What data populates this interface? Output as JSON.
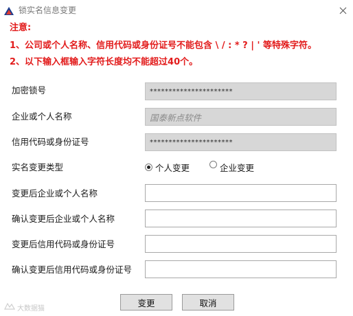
{
  "window": {
    "title": "锁实名信息变更",
    "app_icon": "triangle-logo-icon",
    "close_icon": "close-icon"
  },
  "notice": {
    "title": "注意:",
    "line1": "1、公司或个人名称、信用代码或身份证号不能包含 \\ / : * ? | ' 等特殊字符。",
    "line2": "2、以下输入框输入字符长度均不能超过40个。"
  },
  "form": {
    "lock_no": {
      "label": "加密锁号",
      "value": "**********************"
    },
    "name": {
      "label": "企业或个人名称",
      "value": "国泰新点软件"
    },
    "credit_code": {
      "label": "信用代码或身份证号",
      "value": "**********************"
    },
    "change_type": {
      "label": "实名变更类型",
      "options": [
        "个人变更",
        "企业变更"
      ],
      "selected": "个人变更"
    },
    "new_name": {
      "label": "变更后企业或个人名称",
      "value": ""
    },
    "confirm_new_name": {
      "label": "确认变更后企业或个人名称",
      "value": ""
    },
    "new_code": {
      "label": "变更后信用代码或身份证号",
      "value": ""
    },
    "confirm_new_code": {
      "label": "确认变更后信用代码或身份证号",
      "value": ""
    }
  },
  "buttons": {
    "change": "变更",
    "cancel": "取消"
  },
  "watermark": {
    "text": "大数据猫"
  },
  "colors": {
    "notice_red": "#e21b1b",
    "readonly_bg": "#d7d7d7",
    "button_bg": "#e1e1e1"
  }
}
